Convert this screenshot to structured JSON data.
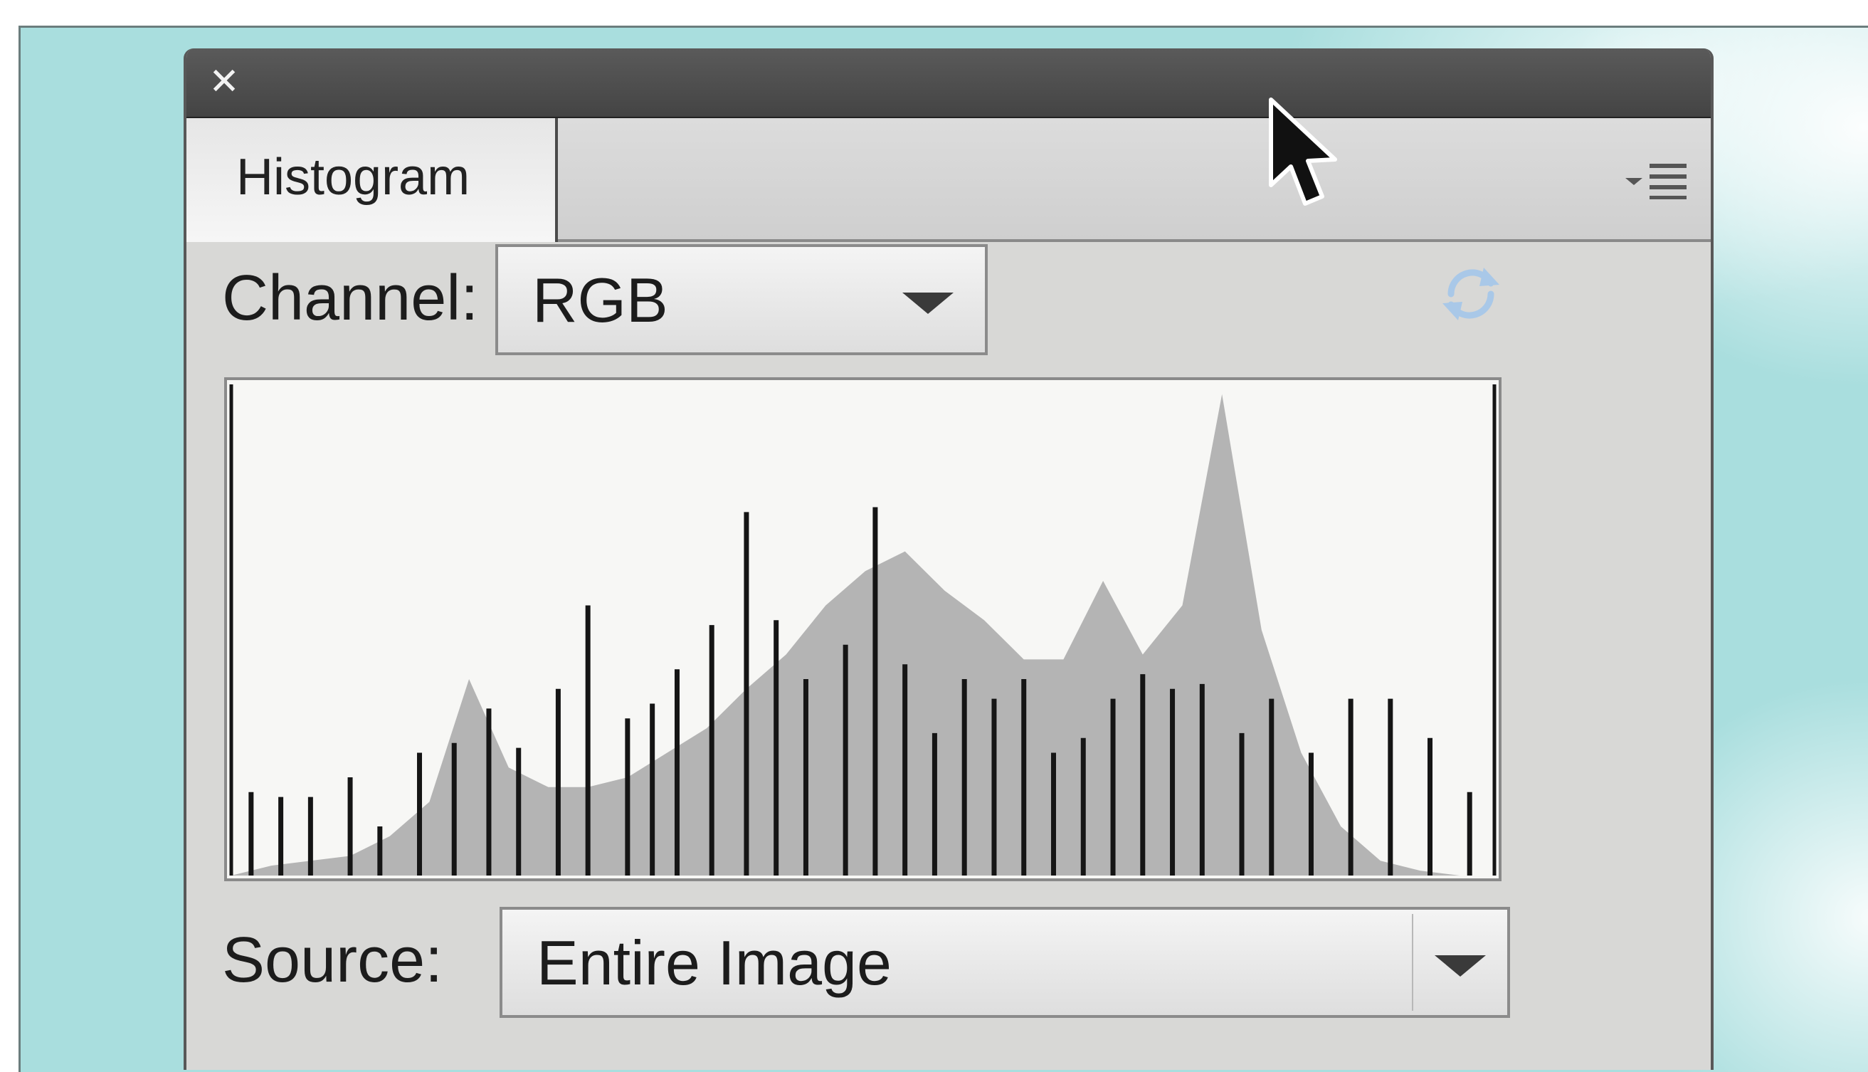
{
  "panel": {
    "close_glyph": "✕",
    "tab_label": "Histogram",
    "menu_icon": "panel-menu-icon"
  },
  "channel": {
    "label": "Channel:",
    "value": "RGB"
  },
  "source": {
    "label": "Source:",
    "value": "Entire Image"
  },
  "icons": {
    "refresh": "refresh-icon",
    "cursor": "mouse-pointer-icon"
  },
  "colors": {
    "backdrop": "#a9dede",
    "panel_bg": "#d8d8d6",
    "titlebar": "#4a4a4a",
    "histogram_bg": "#f7f7f5",
    "luminosity_fill": "#b4b4b4",
    "bars": "#151515",
    "refresh_icon": "#a9c8e8"
  },
  "chart_data": {
    "type": "area",
    "grid": false,
    "x": [
      0,
      8,
      16,
      24,
      32,
      40,
      48,
      56,
      64,
      72,
      80,
      88,
      96,
      104,
      112,
      120,
      128,
      136,
      144,
      152,
      160,
      168,
      176,
      184,
      192,
      200,
      208,
      216,
      224,
      232,
      240,
      248,
      255
    ],
    "series": [
      {
        "values": [
          0.0,
          0.02,
          0.03,
          0.04,
          0.08,
          0.15,
          0.4,
          0.22,
          0.18,
          0.18,
          0.2,
          0.25,
          0.3,
          0.38,
          0.45,
          0.55,
          0.62,
          0.66,
          0.58,
          0.52,
          0.44,
          0.44,
          0.6,
          0.45,
          0.55,
          0.98,
          0.5,
          0.25,
          0.1,
          0.03,
          0.01,
          0.0,
          0.0
        ]
      }
    ],
    "spikes": {
      "x": [
        4,
        10,
        16,
        24,
        30,
        38,
        45,
        52,
        58,
        66,
        72,
        80,
        85,
        90,
        97,
        104,
        110,
        116,
        124,
        130,
        136,
        142,
        148,
        154,
        160,
        166,
        172,
        178,
        184,
        190,
        196,
        204,
        210,
        218,
        226,
        234,
        242,
        250
      ],
      "values": [
        0.17,
        0.16,
        0.16,
        0.2,
        0.1,
        0.25,
        0.27,
        0.34,
        0.26,
        0.38,
        0.55,
        0.32,
        0.35,
        0.42,
        0.51,
        0.74,
        0.52,
        0.4,
        0.47,
        0.75,
        0.43,
        0.29,
        0.4,
        0.36,
        0.4,
        0.25,
        0.28,
        0.36,
        0.41,
        0.38,
        0.39,
        0.29,
        0.36,
        0.25,
        0.36,
        0.36,
        0.28,
        0.17
      ]
    }
  }
}
